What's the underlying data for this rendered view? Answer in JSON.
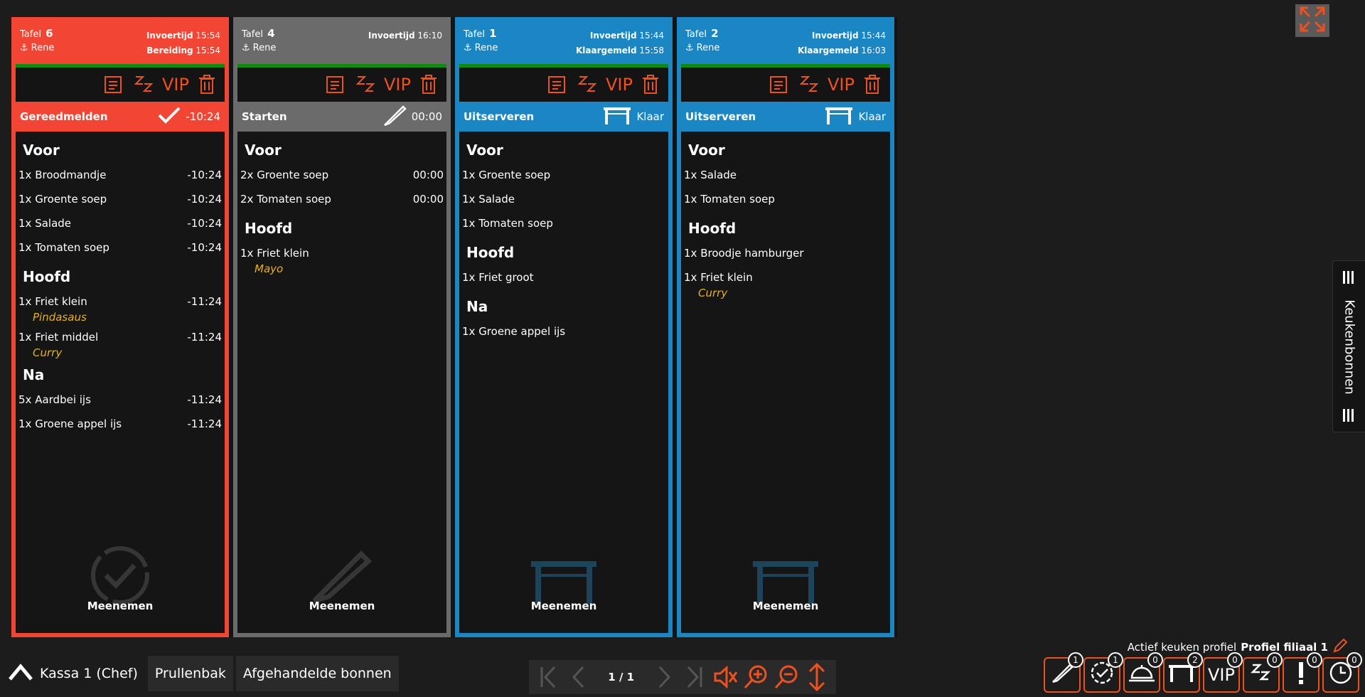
{
  "cards": [
    {
      "table_label": "Tafel",
      "table_number": "6",
      "waiter": "Rene",
      "time1_label": "Invoertijd",
      "time1_value": "15:54",
      "time2_label": "Bereiding",
      "time2_value": "15:54",
      "action_label": "Gereedmelden",
      "action_value": "-10:24",
      "vip_label": "VIP",
      "footer_label": "Meenemen",
      "sections": [
        {
          "name": "Voor",
          "items": [
            {
              "name": "1x Broodmandje",
              "time": "-10:24"
            },
            {
              "name": "1x Groente soep",
              "time": "-10:24"
            },
            {
              "name": "1x Salade",
              "time": "-10:24"
            },
            {
              "name": "1x Tomaten soep",
              "time": "-10:24"
            }
          ]
        },
        {
          "name": "Hoofd",
          "items": [
            {
              "name": "1x Friet klein",
              "time": "-11:24",
              "note": "Pindasaus"
            },
            {
              "name": "1x Friet middel",
              "time": "-11:24",
              "note": "Curry"
            }
          ]
        },
        {
          "name": "Na",
          "items": [
            {
              "name": "5x Aardbei ijs",
              "time": "-11:24"
            },
            {
              "name": "1x Groene appel ijs",
              "time": "-11:24"
            }
          ]
        }
      ]
    },
    {
      "table_label": "Tafel",
      "table_number": "4",
      "waiter": "Rene",
      "time1_label": "Invoertijd",
      "time1_value": "16:10",
      "time2_label": "",
      "time2_value": "",
      "action_label": "Starten",
      "action_value": "00:00",
      "vip_label": "VIP",
      "footer_label": "Meenemen",
      "sections": [
        {
          "name": "Voor",
          "items": [
            {
              "name": "2x Groente soep",
              "time": "00:00"
            },
            {
              "name": "2x Tomaten soep",
              "time": "00:00"
            }
          ]
        },
        {
          "name": "Hoofd",
          "items": [
            {
              "name": "1x Friet klein",
              "time": "",
              "note": "Mayo"
            }
          ]
        }
      ]
    },
    {
      "table_label": "Tafel",
      "table_number": "1",
      "waiter": "Rene",
      "time1_label": "Invoertijd",
      "time1_value": "15:44",
      "time2_label": "Klaargemeld",
      "time2_value": "15:58",
      "action_label": "Uitserveren",
      "action_value": "Klaar",
      "vip_label": "VIP",
      "footer_label": "Meenemen",
      "sections": [
        {
          "name": "Voor",
          "items": [
            {
              "name": "1x Groente soep",
              "time": ""
            },
            {
              "name": "1x Salade",
              "time": ""
            },
            {
              "name": "1x Tomaten soep",
              "time": ""
            }
          ]
        },
        {
          "name": "Hoofd",
          "items": [
            {
              "name": "1x Friet groot",
              "time": ""
            }
          ]
        },
        {
          "name": "Na",
          "items": [
            {
              "name": "1x Groene appel ijs",
              "time": ""
            }
          ]
        }
      ]
    },
    {
      "table_label": "Tafel",
      "table_number": "2",
      "waiter": "Rene",
      "time1_label": "Invoertijd",
      "time1_value": "15:44",
      "time2_label": "Klaargemeld",
      "time2_value": "16:03",
      "action_label": "Uitserveren",
      "action_value": "Klaar",
      "vip_label": "VIP",
      "footer_label": "Meenemen",
      "sections": [
        {
          "name": "Voor",
          "items": [
            {
              "name": "1x Salade",
              "time": ""
            },
            {
              "name": "1x Tomaten soep",
              "time": ""
            }
          ]
        },
        {
          "name": "Hoofd",
          "items": [
            {
              "name": "1x Broodje hamburger",
              "time": ""
            },
            {
              "name": "1x Friet klein",
              "time": "",
              "note": "Curry"
            }
          ]
        }
      ]
    }
  ],
  "side_tab": {
    "label": "Keukenbonnen"
  },
  "profile": {
    "prefix": "Actief keuken profiel",
    "name": "Profiel filiaal 1"
  },
  "bottom": {
    "kassa": "Kassa 1 (Chef)",
    "trash": "Prullenbak",
    "done": "Afgehandelde bonnen"
  },
  "pager": {
    "text": "1 / 1"
  },
  "filters": {
    "badges": [
      "1",
      "1",
      "0",
      "2",
      "0",
      "0",
      "0",
      "0"
    ],
    "vip_label": "VIP"
  },
  "colors": {
    "accent": "#f0501e",
    "red": "#f24533",
    "grey": "#6b6b6b",
    "blue": "#1a86c4",
    "note": "#e8b11d"
  }
}
